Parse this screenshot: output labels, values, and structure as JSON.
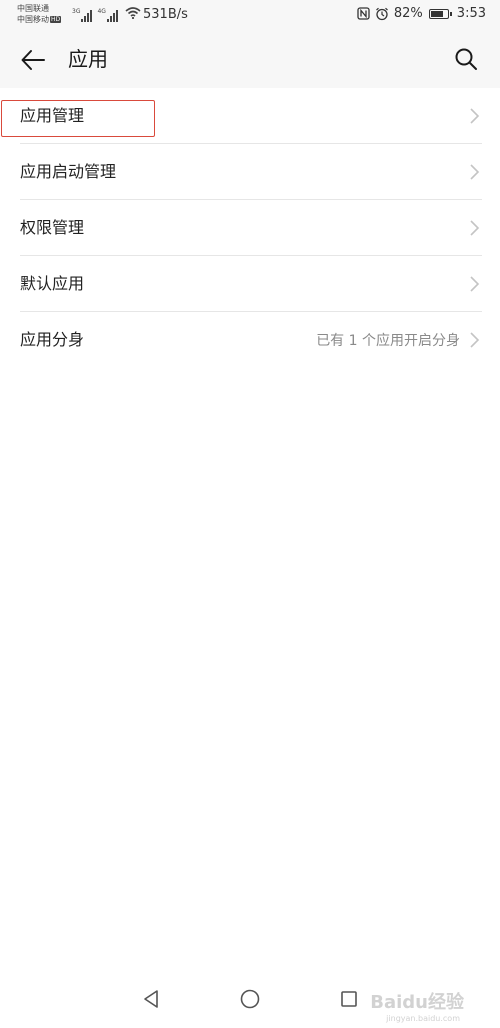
{
  "status_bar": {
    "carrier_1": "中国联通",
    "carrier_2": "中国移动",
    "hd_badge": "HD",
    "net_1": "3G",
    "net_2": "4G",
    "speed": "531B/s",
    "battery": "82%",
    "battery_level": 0.82,
    "time": "3:53"
  },
  "app_bar": {
    "title": "应用",
    "back_icon": "arrow-left-icon",
    "search_icon": "search-icon"
  },
  "settings": {
    "items": [
      {
        "label": "应用管理",
        "value": ""
      },
      {
        "label": "应用启动管理",
        "value": ""
      },
      {
        "label": "权限管理",
        "value": ""
      },
      {
        "label": "默认应用",
        "value": ""
      },
      {
        "label": "应用分身",
        "value": "已有 1 个应用开启分身"
      }
    ]
  },
  "highlight_color": "#d94a3c",
  "watermark": {
    "text": "Baidu经验",
    "sub": "jingyan.baidu.com"
  }
}
